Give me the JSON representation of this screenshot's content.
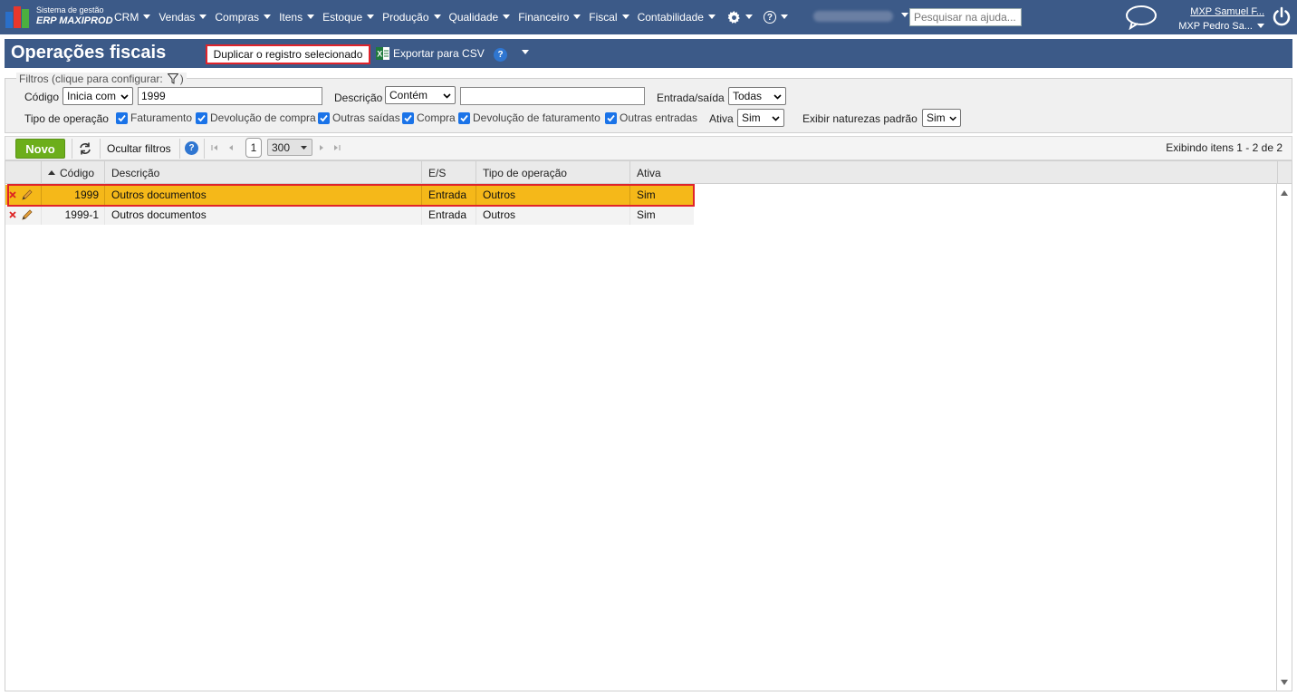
{
  "topbar": {
    "brand_small": "Sistema de gestão",
    "brand_big": "ERP MAXIPROD",
    "menu": [
      "CRM",
      "Vendas",
      "Compras",
      "Itens",
      "Estoque",
      "Produção",
      "Qualidade",
      "Financeiro",
      "Fiscal",
      "Contabilidade"
    ],
    "search_placeholder": "Pesquisar na ajuda...",
    "user1": "MXP Samuel F...",
    "user2": "MXP Pedro Sa..."
  },
  "page": {
    "title": "Operações fiscais",
    "duplicate_label": "Duplicar o registro selecionado",
    "export_label": "Exportar para CSV",
    "help": "?"
  },
  "filters": {
    "legend": "Filtros (clique para configurar:",
    "legend_end": ")",
    "codigo_label": "Código",
    "codigo_op": "Inicia com",
    "codigo_value": "1999",
    "descricao_label": "Descrição",
    "descricao_op": "Contém",
    "descricao_value": "",
    "entrada_label": "Entrada/saída",
    "entrada_value": "Todas",
    "tipo_label": "Tipo de operação",
    "tipos": [
      "Faturamento",
      "Devolução de compra",
      "Outras saídas",
      "Compra",
      "Devolução de faturamento",
      "Outras entradas"
    ],
    "ativa_label": "Ativa",
    "ativa_value": "Sim",
    "naturezas_label": "Exibir naturezas padrão",
    "naturezas_value": "Sim"
  },
  "toolbar": {
    "novo": "Novo",
    "ocultar": "Ocultar filtros",
    "help": "?",
    "page": "1",
    "page_size": "300",
    "showing": "Exibindo itens 1 - 2 de 2"
  },
  "grid": {
    "headers": [
      "Código",
      "Descrição",
      "E/S",
      "Tipo de operação",
      "Ativa"
    ],
    "rows": [
      {
        "codigo": "1999",
        "descricao": "Outros documentos",
        "es": "Entrada",
        "tipo": "Outros",
        "ativa": "Sim"
      },
      {
        "codigo": "1999-1",
        "descricao": "Outros documentos",
        "es": "Entrada",
        "tipo": "Outros",
        "ativa": "Sim"
      }
    ]
  },
  "colors": {
    "header_blue": "#3c5a88",
    "selected_row": "#f5b819",
    "highlight_red": "#e0242b",
    "novo_green": "#6cae1b"
  },
  "icons": [
    "logo",
    "gear-icon",
    "help-icon",
    "chat-icon",
    "power-icon",
    "excel-icon",
    "funnel-icon",
    "refresh-icon",
    "delete-icon",
    "edit-pencil-icon"
  ]
}
